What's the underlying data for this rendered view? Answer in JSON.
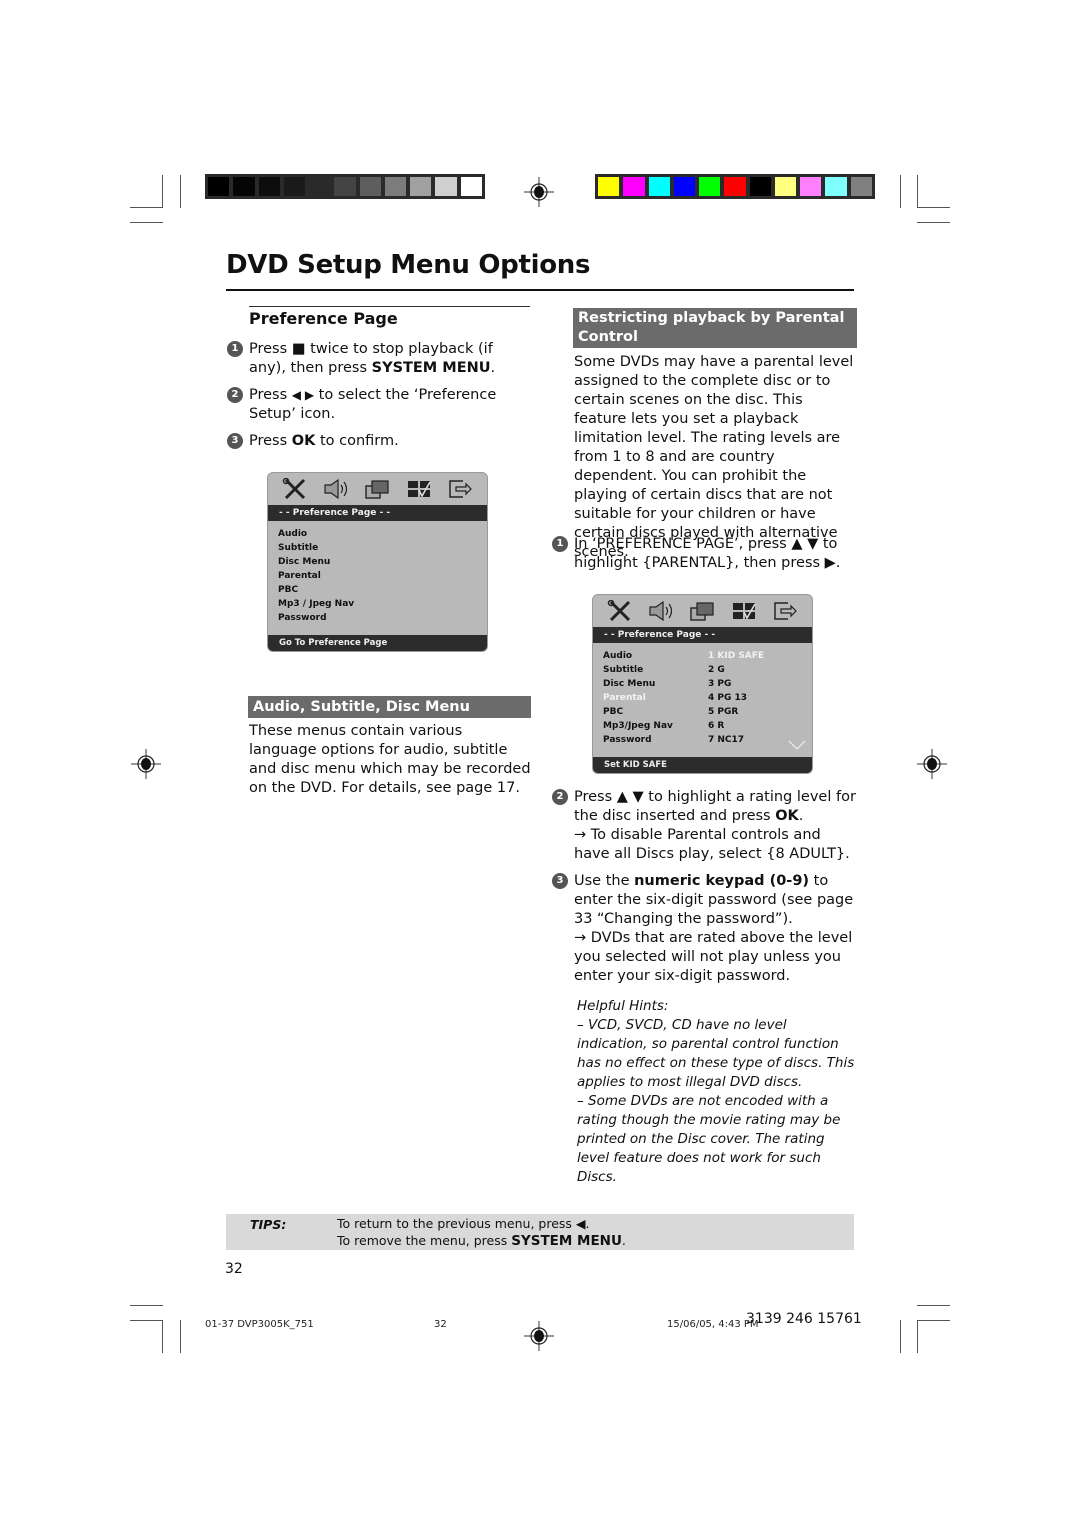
{
  "print_marks": {
    "gray_swatches": [
      "#000000",
      "#050505",
      "#0d0d0d",
      "#1a1a1a",
      "#2a2a2a",
      "#444444",
      "#5e5e5e",
      "#7c7c7c",
      "#a0a0a0",
      "#cfcfcf",
      "#ffffff"
    ],
    "color_swatches": [
      "#ffff00",
      "#ff00ff",
      "#00ffff",
      "#0000ff",
      "#00ff00",
      "#ff0000",
      "#000000",
      "#ffff80",
      "#ff80ff",
      "#80ffff",
      "#808080"
    ]
  },
  "page": {
    "title": "DVD Setup Menu Options",
    "page_number": "32"
  },
  "preference": {
    "heading": "Preference Page",
    "steps": [
      {
        "num": "1",
        "parts": [
          {
            "t": "Press "
          },
          {
            "t": "■",
            "icon": "stop-icon"
          },
          {
            "t": "  twice to stop playback (if any), then press "
          },
          {
            "t": "SYSTEM MENU",
            "b": true
          },
          {
            "t": "."
          }
        ]
      },
      {
        "num": "2",
        "parts": [
          {
            "t": "Press "
          },
          {
            "t": "◀ ▶",
            "icon": "left-right-arrows-icon"
          },
          {
            "t": " to select the ‘Preference Setup’ icon."
          }
        ]
      },
      {
        "num": "3",
        "parts": [
          {
            "t": "Press "
          },
          {
            "t": "OK",
            "b": true
          },
          {
            "t": " to confirm."
          }
        ]
      }
    ]
  },
  "osd1": {
    "header": "- -   Preference Page   - -",
    "items": [
      "Audio",
      "Subtitle",
      "Disc Menu",
      "Parental",
      "PBC",
      "Mp3 / Jpeg Nav",
      "Password"
    ],
    "footer": "Go To Preference Page"
  },
  "audio_section": {
    "heading": "Audio, Subtitle, Disc Menu",
    "body": "These menus contain various language options for audio, subtitle and disc menu which may be recorded on the DVD.  For details, see page 17."
  },
  "parental": {
    "heading": "Restricting playback by Parental Control",
    "intro": "Some DVDs may have a parental level assigned to the complete disc or to certain scenes on the disc. This feature lets you set a playback limitation level. The rating levels are from 1 to 8 and are country dependent. You can prohibit the playing of certain discs that are not suitable for your children or have certain discs played with alternative scenes.",
    "step1": {
      "num": "1",
      "text": "In ‘PREFERENCE PAGE’, press ▲ ▼ to highlight {PARENTAL}, then press ▶."
    },
    "step2": {
      "num": "2",
      "pre": "Press ▲ ▼ to highlight a rating level for the disc inserted and press ",
      "bold": "OK",
      "post": ".",
      "note": "→ To disable Parental controls and have all Discs play, select {8 ADULT}."
    },
    "step3": {
      "num": "3",
      "pre": "Use the ",
      "bold": "numeric keypad (0-9)",
      "post": " to enter the six-digit password (see page 33 “Changing the password”).",
      "note": "→ DVDs that are rated above the level you selected will not play unless you enter your six-digit password."
    },
    "hints_title": "Helpful Hints:",
    "hints": [
      "–    VCD, SVCD, CD have no level indication, so parental control function has no effect on these type of discs. This applies to most illegal DVD discs.",
      "–    Some DVDs are not encoded with a rating though the movie rating may be printed on the Disc cover. The rating level feature does not work for such Discs."
    ]
  },
  "osd2": {
    "header": "- -   Preference Page   - -",
    "items": [
      "Audio",
      "Subtitle",
      "Disc Menu",
      "Parental",
      "PBC",
      "Mp3/Jpeg Nav",
      "Password"
    ],
    "highlighted_item": "Parental",
    "ratings": [
      "1 KID SAFE",
      "2 G",
      "3 PG",
      "4 PG 13",
      "5 PGR",
      "6 R",
      "7 NC17"
    ],
    "highlighted_rating": "1 KID SAFE",
    "footer": "Set KID SAFE"
  },
  "tips": {
    "label": "TIPS:",
    "line1": "To return to the previous menu, press ◀.",
    "line2_pre": "To remove the menu, press ",
    "line2_bold": "SYSTEM MENU",
    "line2_post": "."
  },
  "footer": {
    "file": "01-37 DVP3005K_751",
    "page": "32",
    "timestamp": "15/06/05, 4:43 PM",
    "code": "3139 246 15761"
  }
}
